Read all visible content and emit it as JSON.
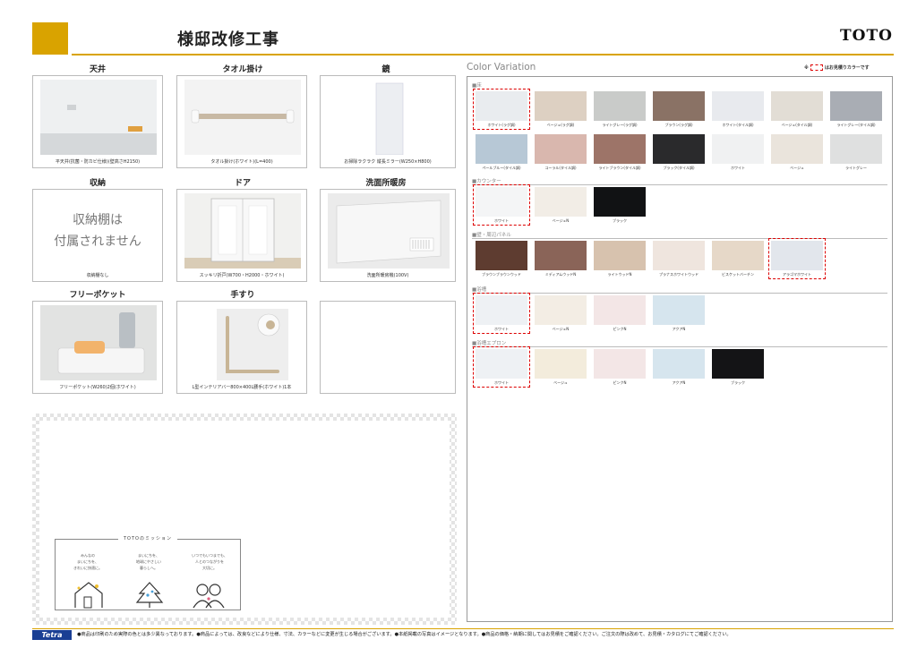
{
  "header": {
    "title": "様邸改修工事",
    "brand": "TOTO"
  },
  "equipment": [
    {
      "label": "天井",
      "caption": "平天井(抗菌・防カビ仕様)(壁高さH2150)"
    },
    {
      "label": "タオル掛け",
      "caption": "タオル掛け(ホワイト)(L=400)"
    },
    {
      "label": "鏡",
      "caption": "お掃除ラクラク 縦長ミラー(W250×H800)"
    },
    {
      "label": "収納",
      "caption": "収納棚なし",
      "placeholder_line1": "収納棚は",
      "placeholder_line2": "付属されません"
    },
    {
      "label": "ドア",
      "caption": "スッキリ折戸(W700・H2000・ホワイト)"
    },
    {
      "label": "洗面所暖房",
      "caption": "洗面所暖房機(100V)"
    },
    {
      "label": "フリーポケット",
      "caption": "フリーポケット(W260)2個(ホワイト)"
    },
    {
      "label": "手すり",
      "caption": "L型インテリアバー800×400L腰手(ホワイト)1本"
    }
  ],
  "mission": {
    "title": "TOTOのミッション",
    "items": [
      "みんなの\nまいにちを、\nきれいに快適に。",
      "まいにちを、\n地球にやさしい\n暮らしへ。",
      "いつでもいつまでも、\n人とのつながりを\n大切に。"
    ]
  },
  "color_variation": {
    "title": "Color Variation",
    "note_prefix": "※",
    "note_suffix": "はお見積りカラーです",
    "sections": [
      {
        "name": "■床",
        "rows": [
          [
            {
              "name": "ホワイト(ラグ調)",
              "color": "#e9ecef",
              "selected": true
            },
            {
              "name": "ベージュ(ラグ調)",
              "color": "#ddd0c2"
            },
            {
              "name": "ライトグレー(ラグ調)",
              "color": "#c9cbc9"
            },
            {
              "name": "ブラウン(ラグ調)",
              "color": "#8a7265"
            },
            {
              "name": "ホワイト(タイル調)",
              "color": "#e8eaee"
            },
            {
              "name": "ベージュ(タイル調)",
              "color": "#e2ddd5"
            },
            {
              "name": "ライトグレー(タイル調)",
              "color": "#a9adb4"
            }
          ],
          [
            {
              "name": "ペールブルー(タイル調)",
              "color": "#b7c8d6"
            },
            {
              "name": "コーラル(タイル調)",
              "color": "#d9b7ae"
            },
            {
              "name": "ライトブラウン(タイル調)",
              "color": "#9d7468"
            },
            {
              "name": "ブラック(タイル調)",
              "color": "#2a2a2c"
            },
            {
              "name": "ホワイト",
              "color": "#f0f1f2"
            },
            {
              "name": "ベージュ",
              "color": "#eae4dc"
            },
            {
              "name": "ライトグレー",
              "color": "#dfe0e0"
            }
          ]
        ]
      },
      {
        "name": "■カウンター",
        "rows": [
          [
            {
              "name": "ホワイト",
              "color": "#f4f5f6",
              "selected": true
            },
            {
              "name": "ベージュN",
              "color": "#f2ede6"
            },
            {
              "name": "ブラック",
              "color": "#111214"
            }
          ]
        ]
      },
      {
        "name": "■壁・周辺パネル",
        "rows": [
          [
            {
              "name": "ブラウンブラウンウッド",
              "color": "#5e3c30"
            },
            {
              "name": "ミディアムウッドN",
              "color": "#8a6458"
            },
            {
              "name": "ライトウッドN",
              "color": "#d7c2ae"
            },
            {
              "name": "プラナスホワイトウッド",
              "color": "#efe5de"
            },
            {
              "name": "ビスケットバーチン",
              "color": "#e6d8c8"
            },
            {
              "name": "アラゴマホワイト",
              "color": "#e2e6ec",
              "selected": true
            }
          ]
        ]
      },
      {
        "name": "■浴槽",
        "rows": [
          [
            {
              "name": "ホワイト",
              "color": "#eef1f4",
              "selected": true
            },
            {
              "name": "ベージュN",
              "color": "#f3ede4"
            },
            {
              "name": "ピンクN",
              "color": "#f3e6e6"
            },
            {
              "name": "アクアN",
              "color": "#d6e5ee"
            }
          ]
        ]
      },
      {
        "name": "■浴槽エプロン",
        "rows": [
          [
            {
              "name": "ホワイト",
              "color": "#eef1f4",
              "selected": true
            },
            {
              "name": "ベージュ",
              "color": "#f3ecdc"
            },
            {
              "name": "ピンクN",
              "color": "#f3e6e6"
            },
            {
              "name": "アクアN",
              "color": "#d6e5ee"
            },
            {
              "name": "ブラック",
              "color": "#141416"
            }
          ]
        ]
      }
    ]
  },
  "footer": {
    "logo": "Tetra",
    "text": "●商品は印刷のため実際の色とは多少異なっております。●商品によっては、改良などにより仕様、寸法、カラーなどに変更が生じる場合がございます。●本紙掲載の写真はイメージとなります。●商品の価格・納期に関してはお見積をご確認ください。ご注文の際は改めて、お見積・カタログにてご確認ください。"
  },
  "colors": {
    "accent": "#d9a300",
    "selected_outline": "#dd0000",
    "footer_logo_bg": "#1a3f94"
  }
}
